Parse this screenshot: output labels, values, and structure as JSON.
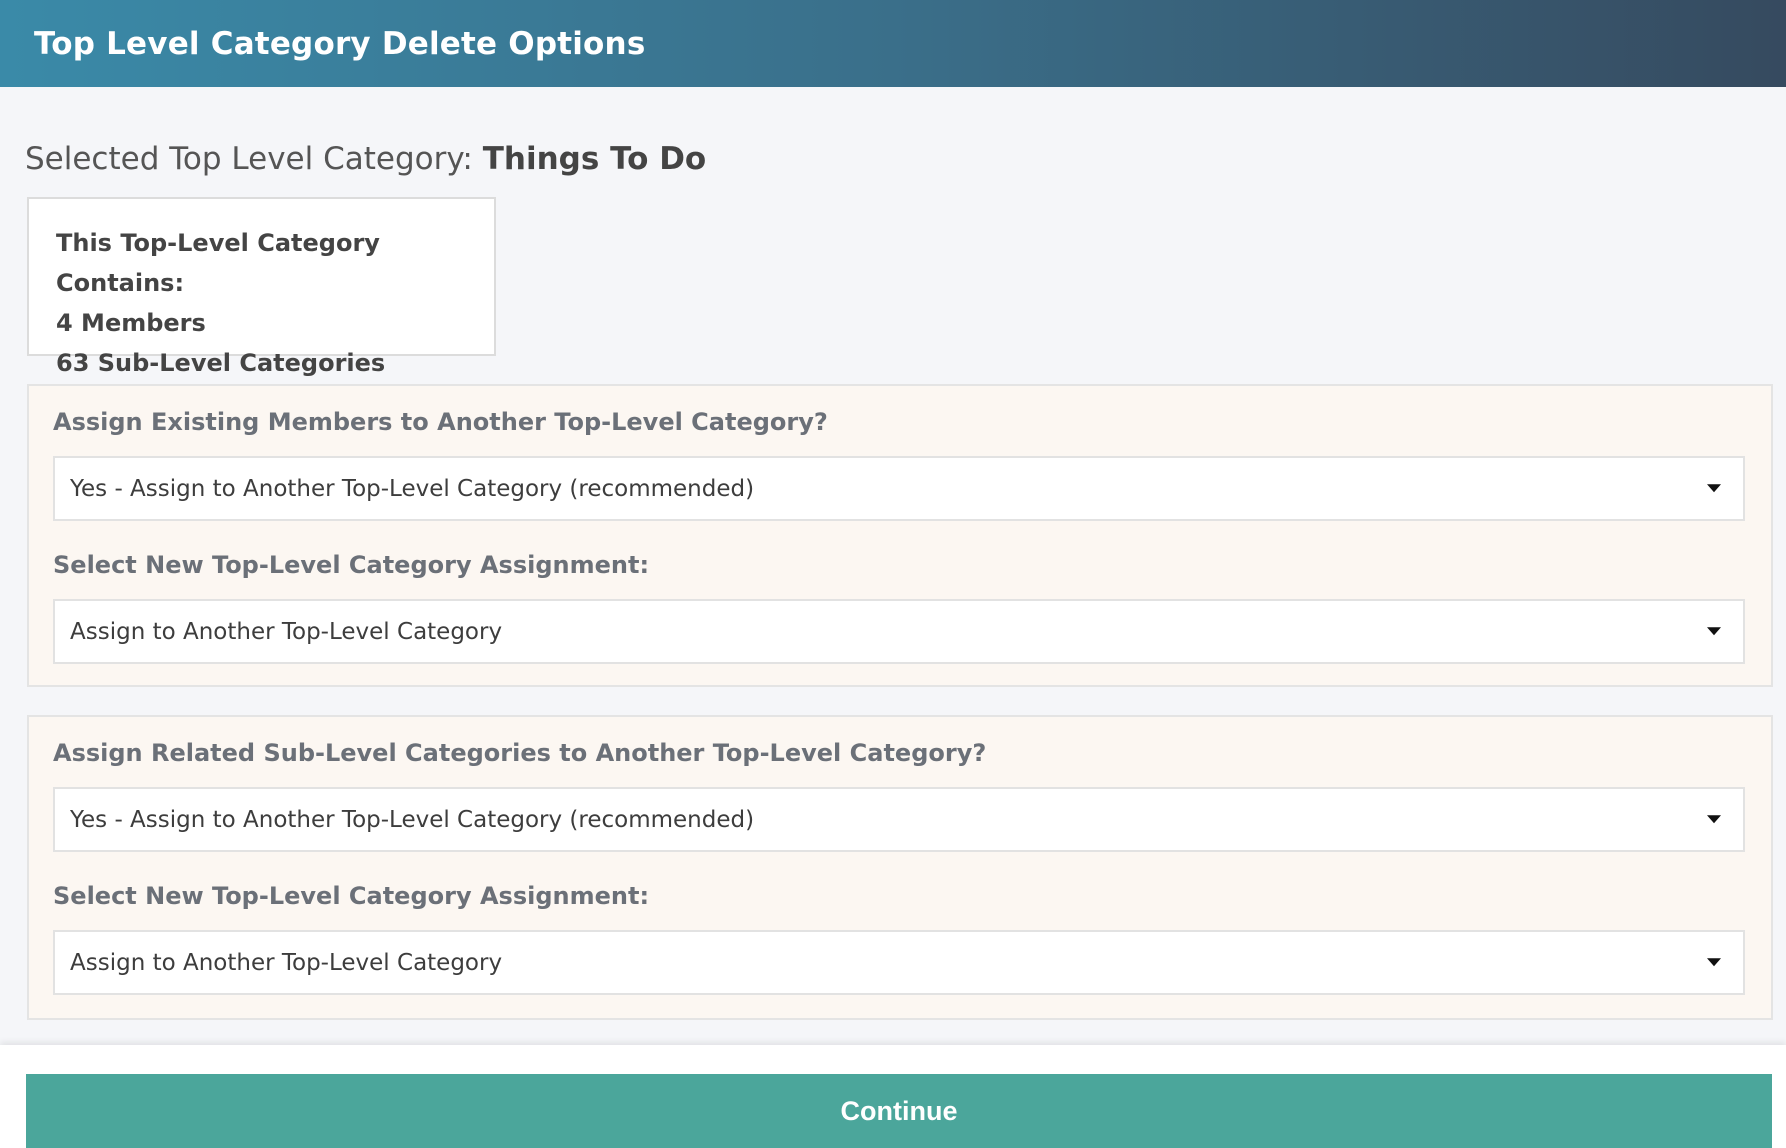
{
  "header": {
    "title": "Top Level Category Delete Options"
  },
  "selected": {
    "label": "Selected Top Level Category: ",
    "value": "Things To Do"
  },
  "summary": {
    "heading": "This Top-Level Category Contains:",
    "members": "4 Members",
    "sub_categories": "63 Sub-Level Categories"
  },
  "members_panel": {
    "question": "Assign Existing Members to Another Top-Level Category?",
    "assign_option": "Yes - Assign to Another Top-Level Category (recommended)",
    "new_assignment_label": "Select New Top-Level Category Assignment:",
    "new_assignment_value": "Assign to Another Top-Level Category"
  },
  "subcats_panel": {
    "question": "Assign Related Sub-Level Categories to Another Top-Level Category?",
    "assign_option": "Yes - Assign to Another Top-Level Category (recommended)",
    "new_assignment_label": "Select New Top-Level Category Assignment:",
    "new_assignment_value": "Assign to Another Top-Level Category"
  },
  "footer": {
    "continue_label": "Continue"
  },
  "colors": {
    "header_start": "#3a8aa8",
    "header_end": "#364a5f",
    "panel_bg": "#fcf7f2",
    "continue_button": "#4ba69b"
  },
  "icons": {
    "select_caret": "chevron-down-icon"
  }
}
